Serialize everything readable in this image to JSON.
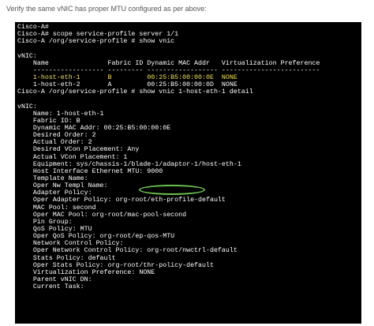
{
  "caption": "Verify the same vNIC has proper MTU configured as per above:",
  "terminal": {
    "lines": [
      "Cisco-A#",
      "Cisco-A# scope service-profile server 1/1",
      "Cisco-A /org/service-profile # show vnic",
      "",
      "vNIC:",
      "    Name               Fabric ID Dynamic MAC Addr   Virtualization Preference",
      "    ------------------ --------- ------------------ -------------------------",
      "    1-host-eth-1       B         00:25:B5:00:00:0E  NONE",
      "    1-host-eth-2       A         00:25:B5:00:00:0D  NONE",
      "Cisco-A /org/service-profile # show vnic 1-host-eth-1 detail",
      "",
      "vNIC:",
      "    Name: 1-host-eth-1",
      "    Fabric ID: B",
      "    Dynamic MAC Addr: 00:25:B5:00:00:0E",
      "    Desired Order: 2",
      "    Actual Order: 2",
      "    Desired VCon Placement: Any",
      "    Actual VCon Placement: 1",
      "    Equipment: sys/chassis-1/blade-1/adaptor-1/host-eth-1",
      "    Host Interface Ethernet MTU: 9000",
      "    Template Name:",
      "    Oper Nw Templ Name:",
      "    Adapter Policy:",
      "    Oper Adapter Policy: org-root/eth-profile-default",
      "    MAC Pool: second",
      "    Oper MAC Pool: org-root/mac-pool-second",
      "    Pin Group:",
      "    QoS Policy: MTU",
      "    Oper QoS Policy: org-root/ep-qos-MTU",
      "    Network Control Policy:",
      "    Oper Network Control Policy: org-root/nwctrl-default",
      "    Stats Policy: default",
      "    Oper Stats Policy: org-root/thr-policy-default",
      "    Virtualization Preference: NONE",
      "    Parent vNIC DN:",
      "    Current Task:"
    ],
    "highlight_color": "#6bbf4e",
    "row_text_color": "#f2e15a"
  }
}
